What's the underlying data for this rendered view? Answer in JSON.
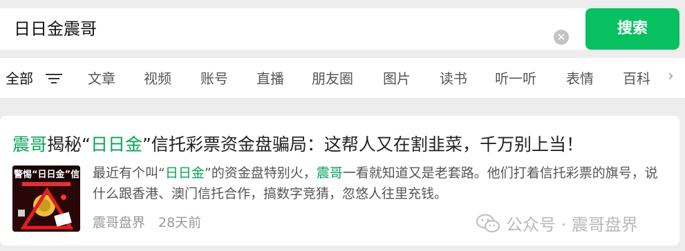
{
  "search": {
    "query": "日日金震哥",
    "button_label": "搜索"
  },
  "tabs": [
    {
      "label": "全部",
      "active": true
    },
    {
      "label": "文章"
    },
    {
      "label": "视频"
    },
    {
      "label": "账号"
    },
    {
      "label": "直播"
    },
    {
      "label": "朋友圈"
    },
    {
      "label": "图片"
    },
    {
      "label": "读书"
    },
    {
      "label": "听一听"
    },
    {
      "label": "表情"
    },
    {
      "label": "百科"
    }
  ],
  "result": {
    "title_parts": [
      "震哥",
      "揭秘“",
      "日日金",
      "”信托彩票资金盘骗局：这帮人又在割韭菜，千万别上当！"
    ],
    "snippet_parts": [
      "最近有个叫“",
      "日日金",
      "”的资金盘特别火，",
      "震哥",
      "一看就知道又是老套路。他们打着信托彩票的旗号，说什么跟香港、澳门信托合作，搞数字竞猜，忽悠人往里充钱。"
    ],
    "source": "震哥盘界",
    "time": "28天前",
    "thumb_text": "警惕“日日金”信"
  },
  "watermark": {
    "icon": "wechat-icon",
    "text": "公众号 · 震哥盘界"
  },
  "colors": {
    "accent": "#07c160",
    "highlight": "#07a356"
  }
}
